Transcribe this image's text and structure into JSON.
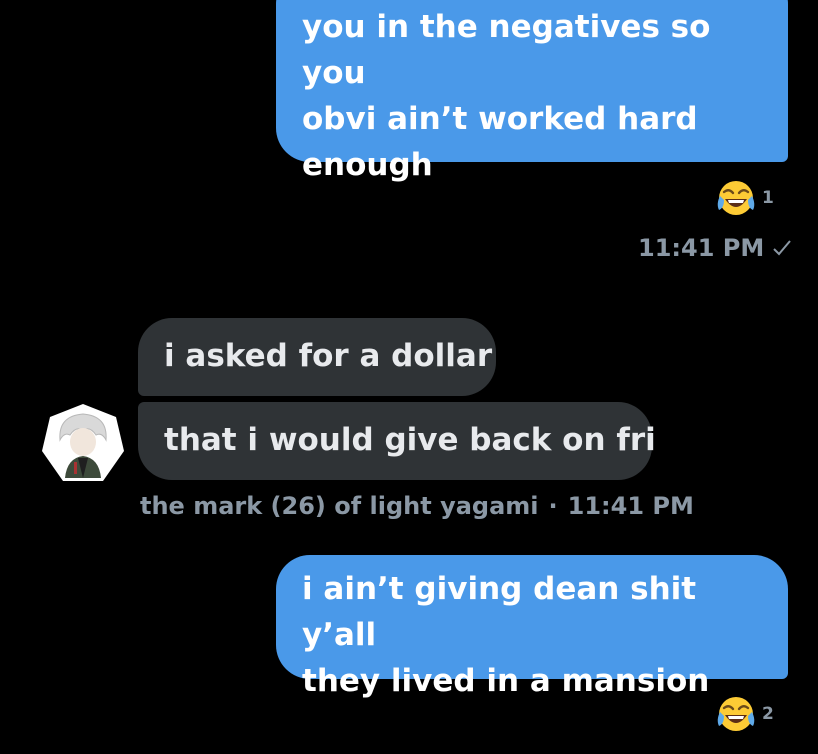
{
  "messages": [
    {
      "text": "you in the negatives so you\nobvi ain’t worked hard\nenough",
      "reaction_count": "1",
      "time": "11:41 PM"
    },
    {
      "text": "i asked for a dollar"
    },
    {
      "text": "that i would give back on fri",
      "sender": "the mark (26) of light yagami",
      "separator": "·",
      "time": "11:41 PM"
    },
    {
      "text": "i ain’t giving dean shit y’all\nthey lived in a mansion",
      "reaction_count": "2"
    }
  ],
  "reaction_emoji": "face-with-tears-of-joy-icon",
  "colors": {
    "background": "#000000",
    "outgoing_bubble": "#4a99e9",
    "incoming_bubble": "#2f3336",
    "meta_text": "#8b98a5"
  }
}
